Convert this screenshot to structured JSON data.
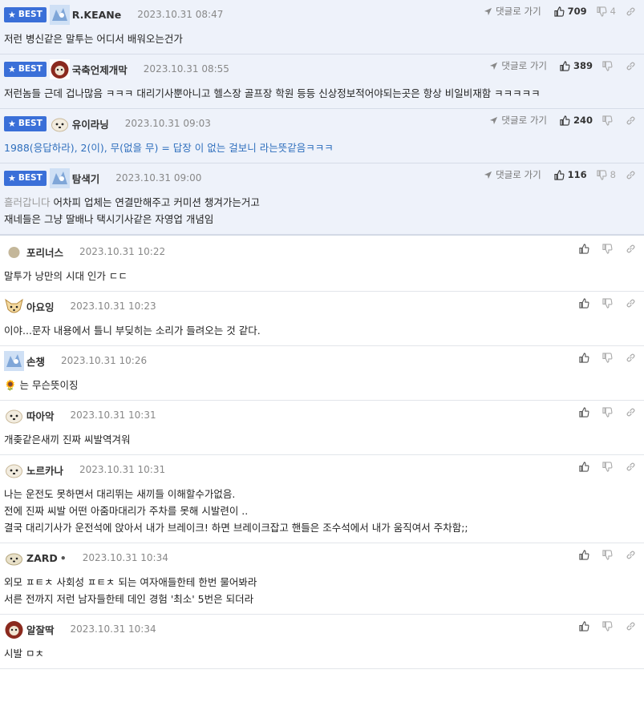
{
  "labels": {
    "best": "BEST",
    "reply": "댓글로 가기"
  },
  "colors": {
    "best_badge": "#3a6fd8",
    "best_bg": "#eef2fa",
    "blue_text": "#2f6fbd"
  },
  "best_comments": [
    {
      "nick": "R.KEANe",
      "time": "2023.10.31 08:47",
      "likes": "709",
      "dislikes": "4",
      "prefix": "",
      "text": "저런 병신같은 말투는 어디서 배워오는건가"
    },
    {
      "nick": "국축언제개막",
      "time": "2023.10.31 08:55",
      "likes": "389",
      "dislikes": "",
      "prefix": "",
      "text": "저런놈들 근데 겁나많음 ㅋㅋㅋ 대리기사뿐아니고 헬스장 골프장 학원 등등 신상정보적어야되는곳은 항상 비일비재함 ㅋㅋㅋㅋㅋ"
    },
    {
      "nick": "유이라닝",
      "time": "2023.10.31 09:03",
      "likes": "240",
      "dislikes": "",
      "prefix": "",
      "text": "1988(응답하라), 2(이), 무(없을 무) = 답장 이 없는 걸보니 라는뜻같음ㅋㅋㅋ"
    },
    {
      "nick": "탐색기",
      "time": "2023.10.31 09:00",
      "likes": "116",
      "dislikes": "8",
      "prefix": "흘러갑니다",
      "text": " 어차피 업체는 연결만해주고 커미션 챙겨가는거고\n재네들은 그냥 딸배나 택시기사같은 자영업 개념임"
    }
  ],
  "comments": [
    {
      "nick": "포리너스",
      "time": "2023.10.31 10:22",
      "text": "말투가 낭만의 시대 인가 ㄷㄷ"
    },
    {
      "nick": "아요잉",
      "time": "2023.10.31 10:23",
      "text": "이야...문자 내용에서 틀니 부딪히는 소리가 들려오는 것 같다."
    },
    {
      "nick": "손챙",
      "time": "2023.10.31 10:26",
      "text": "🌻 는 무슨뜻이징"
    },
    {
      "nick": "따아악",
      "time": "2023.10.31 10:31",
      "text": "개좆같은새끼 진짜 씨발역겨워"
    },
    {
      "nick": "노르카나",
      "time": "2023.10.31 10:31",
      "text": "나는 운전도 못하면서 대리뛰는 새끼들 이해할수가없음.\n전에 진짜 씨발 어떤 아줌마대리가 주차를 못해 시발련이 ..\n결국 대리기사가 운전석에 앉아서 내가 브레이크! 하면 브레이크잡고 핸들은 조수석에서 내가 움직여서 주차함;;"
    },
    {
      "nick": "ZARD",
      "nick_suffix": "•",
      "time": "2023.10.31 10:34",
      "text": "외모 ㅍㅌㅊ 사회성 ㅍㅌㅊ 되는 여자애들한테 한번 물어봐라\n서른 전까지 저런 남자들한테 데인 경험 '최소' 5번은 되더라"
    },
    {
      "nick": "알잘딱",
      "time": "2023.10.31 10:34",
      "text": "시발 ㅁㅊ"
    }
  ]
}
